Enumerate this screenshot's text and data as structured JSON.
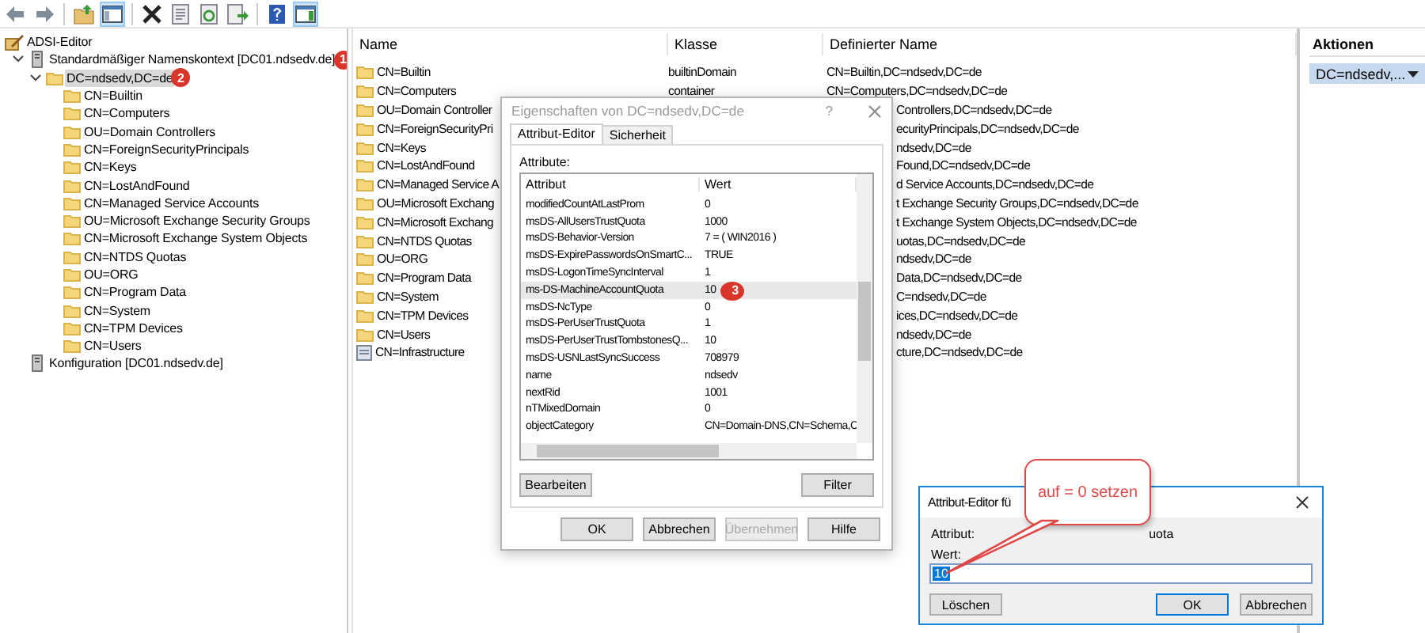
{
  "toolbar": {
    "buttons": [
      {
        "kind": "back",
        "pressed": false
      },
      {
        "kind": "forward",
        "pressed": false
      },
      {
        "kind": "separator"
      },
      {
        "kind": "up",
        "pressed": false
      },
      {
        "kind": "console",
        "pressed": true
      },
      {
        "kind": "separator"
      },
      {
        "kind": "delete",
        "pressed": false
      },
      {
        "kind": "properties",
        "pressed": false
      },
      {
        "kind": "refresh",
        "pressed": false
      },
      {
        "kind": "export",
        "pressed": false
      },
      {
        "kind": "separator"
      },
      {
        "kind": "help",
        "pressed": false
      },
      {
        "kind": "pane",
        "pressed": true
      }
    ]
  },
  "tree": {
    "root": {
      "kind": "console",
      "label": "ADSI-Editor",
      "selected": false,
      "children": [
        {
          "kind": "server",
          "label": "Standardmäßiger Namenskontext [DC01.ndsedv.de]",
          "badge": "1",
          "expanded": true,
          "selected": false,
          "children": [
            {
              "kind": "folder",
              "label": "DC=ndsedv,DC=de",
              "badge": "2",
              "expanded": true,
              "selected": true,
              "children": [
                {
                  "kind": "folder",
                  "label": "CN=Builtin",
                  "selected": false
                },
                {
                  "kind": "folder",
                  "label": "CN=Computers",
                  "selected": false
                },
                {
                  "kind": "folder",
                  "label": "OU=Domain Controllers",
                  "selected": false
                },
                {
                  "kind": "folder",
                  "label": "CN=ForeignSecurityPrincipals",
                  "selected": false
                },
                {
                  "kind": "folder",
                  "label": "CN=Keys",
                  "selected": false
                },
                {
                  "kind": "folder",
                  "label": "CN=LostAndFound",
                  "selected": false
                },
                {
                  "kind": "folder",
                  "label": "CN=Managed Service Accounts",
                  "selected": false
                },
                {
                  "kind": "folder",
                  "label": "OU=Microsoft Exchange Security Groups",
                  "selected": false
                },
                {
                  "kind": "folder",
                  "label": "CN=Microsoft Exchange System Objects",
                  "selected": false
                },
                {
                  "kind": "folder",
                  "label": "CN=NTDS Quotas",
                  "selected": false
                },
                {
                  "kind": "folder",
                  "label": "OU=ORG",
                  "selected": false
                },
                {
                  "kind": "folder",
                  "label": "CN=Program Data",
                  "selected": false
                },
                {
                  "kind": "folder",
                  "label": "CN=System",
                  "selected": false
                },
                {
                  "kind": "folder",
                  "label": "CN=TPM Devices",
                  "selected": false
                },
                {
                  "kind": "folder",
                  "label": "CN=Users",
                  "selected": false
                }
              ]
            }
          ]
        },
        {
          "kind": "server",
          "label": "Konfiguration [DC01.ndsedv.de]",
          "selected": false
        }
      ]
    }
  },
  "list": {
    "columns": [
      "Name",
      "Klasse",
      "Definierter Name"
    ],
    "rows": [
      {
        "kind": "folder",
        "name": "CN=Builtin",
        "class": "builtinDomain",
        "dn": "CN=Builtin,DC=ndsedv,DC=de"
      },
      {
        "kind": "folder",
        "name": "CN=Computers",
        "class": "container",
        "dn": "CN=Computers,DC=ndsedv,DC=de"
      },
      {
        "kind": "folder",
        "name": "OU=Domain Controller",
        "dn": "Controllers,DC=ndsedv,DC=de"
      },
      {
        "kind": "folder",
        "name": "CN=ForeignSecurityPri",
        "dn": "ecurityPrincipals,DC=ndsedv,DC=de"
      },
      {
        "kind": "folder",
        "name": "CN=Keys",
        "dn": "ndsedv,DC=de"
      },
      {
        "kind": "folder",
        "name": "CN=LostAndFound",
        "dn": "Found,DC=ndsedv,DC=de"
      },
      {
        "kind": "folder",
        "name": "CN=Managed Service A",
        "dn": "d Service Accounts,DC=ndsedv,DC=de"
      },
      {
        "kind": "folder",
        "name": "OU=Microsoft Exchang",
        "dn": "t Exchange Security Groups,DC=ndsedv,DC=de"
      },
      {
        "kind": "folder",
        "name": "CN=Microsoft Exchang",
        "dn": "t Exchange System Objects,DC=ndsedv,DC=de"
      },
      {
        "kind": "folder",
        "name": "CN=NTDS Quotas",
        "dn": "uotas,DC=ndsedv,DC=de"
      },
      {
        "kind": "folder",
        "name": "OU=ORG",
        "dn": "ndsedv,DC=de"
      },
      {
        "kind": "folder",
        "name": "CN=Program Data",
        "dn": "Data,DC=ndsedv,DC=de"
      },
      {
        "kind": "folder",
        "name": "CN=System",
        "dn": "C=ndsedv,DC=de"
      },
      {
        "kind": "folder",
        "name": "CN=TPM Devices",
        "dn": "ices,DC=ndsedv,DC=de"
      },
      {
        "kind": "folder",
        "name": "CN=Users",
        "dn": "ndsedv,DC=de"
      },
      {
        "kind": "infrastructure",
        "name": "CN=Infrastructure",
        "dn": "cture,DC=ndsedv,DC=de"
      }
    ]
  },
  "actions": {
    "title": "Aktionen",
    "items": [
      {
        "label": "DC=ndsedv,...",
        "selected": true
      }
    ]
  },
  "properties_dialog": {
    "title": "Eigenschaften von DC=ndsedv,DC=de",
    "help": "?",
    "tabs": [
      {
        "label": "Attribut-Editor",
        "selected": true
      },
      {
        "label": "Sicherheit",
        "selected": false
      }
    ],
    "attributes_label": "Attribute:",
    "columns": [
      "Attribut",
      "Wert"
    ],
    "rows": [
      {
        "attribute": "modifiedCountAtLastProm",
        "value": "0",
        "selected": false
      },
      {
        "attribute": "msDS-AllUsersTrustQuota",
        "value": "1000",
        "selected": false
      },
      {
        "attribute": "msDS-Behavior-Version",
        "value": "7 = ( WIN2016 )",
        "selected": false
      },
      {
        "attribute": "msDS-ExpirePasswordsOnSmartC...",
        "value": "TRUE",
        "selected": false
      },
      {
        "attribute": "msDS-LogonTimeSyncInterval",
        "value": "1",
        "selected": false
      },
      {
        "attribute": "ms-DS-MachineAccountQuota",
        "value": "10",
        "badge": "3",
        "selected": true
      },
      {
        "attribute": "msDS-NcType",
        "value": "0",
        "selected": false
      },
      {
        "attribute": "msDS-PerUserTrustQuota",
        "value": "1",
        "selected": false
      },
      {
        "attribute": "msDS-PerUserTrustTombstonesQ...",
        "value": "10",
        "selected": false
      },
      {
        "attribute": "msDS-USNLastSyncSuccess",
        "value": "708979",
        "selected": false
      },
      {
        "attribute": "name",
        "value": "ndsedv",
        "selected": false
      },
      {
        "attribute": "nextRid",
        "value": "1001",
        "selected": false
      },
      {
        "attribute": "nTMixedDomain",
        "value": "0",
        "selected": false
      },
      {
        "attribute": "objectCategory",
        "value": "CN=Domain-DNS,CN=Schema,C",
        "selected": false
      }
    ],
    "edit_button": "Bearbeiten",
    "filter_button": "Filter",
    "buttons": [
      {
        "label": "OK",
        "disabled": false
      },
      {
        "label": "Abbrechen",
        "disabled": false
      },
      {
        "label": "Übernehmen",
        "disabled": true
      },
      {
        "label": "Hilfe",
        "disabled": false
      }
    ]
  },
  "attribute_editor": {
    "title": "Attribut-Editor fü",
    "attribute_label": "Attribut:",
    "attribute_value": "uota",
    "value_label": "Wert:",
    "value": "10",
    "text_selected": true,
    "buttons": [
      {
        "label": "Löschen",
        "kind": "clear"
      },
      {
        "label": "OK",
        "kind": "ok"
      },
      {
        "label": "Abbrechen",
        "kind": "cancel"
      }
    ]
  },
  "callout": {
    "text": "auf = 0 setzen"
  }
}
